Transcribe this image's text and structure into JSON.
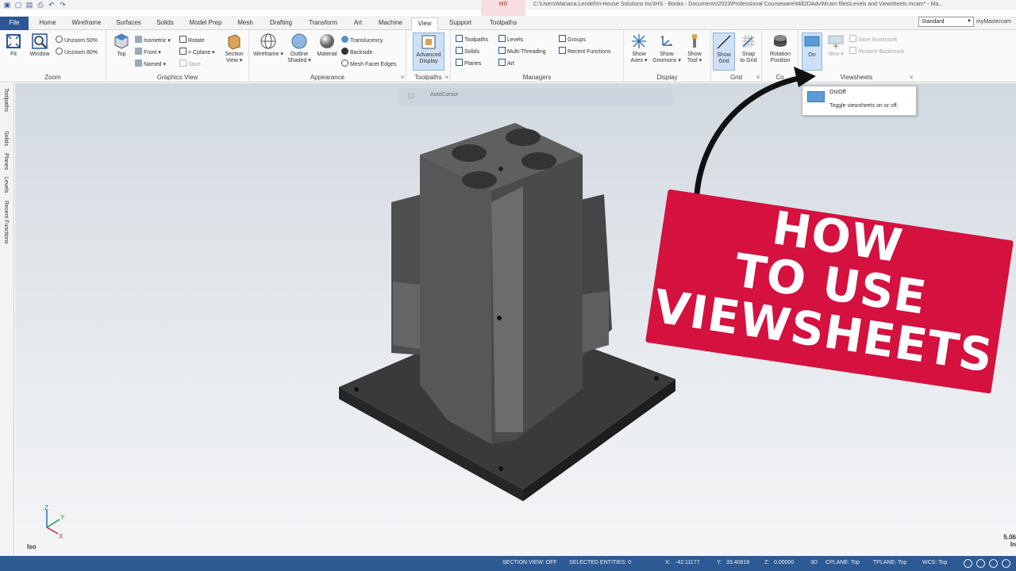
{
  "window": {
    "title": "C:\\Users\\Mariana.Lendel\\In-House Solutions Inc\\IHS - Books - Documents\\2023\\Professional Courseware\\Mill2DAdv\\Mcam files\\Levels and Viewsheets.mcam* - Ma...",
    "context_group": "Mill"
  },
  "tabs": [
    "File",
    "Home",
    "Wireframe",
    "Surfaces",
    "Solids",
    "Model Prep",
    "Mesh",
    "Drafting",
    "Transform",
    "Art",
    "Machine",
    "View",
    "Support",
    "Toolpaths"
  ],
  "active_tab": "View",
  "config_select": "Standard",
  "my_mastercam": "myMastercam",
  "ribbon": {
    "zoom": {
      "label": "Zoom",
      "fit": "Fit",
      "window": "Window",
      "unzoom50": "Unzoom 50%",
      "unzoom80": "Unzoom 80%"
    },
    "graphics_view": {
      "label": "Graphics View",
      "top": "Top",
      "isometric": "Isometric",
      "front": "Front",
      "named": "Named",
      "rotate": "Rotate",
      "cplane": "= Cplane",
      "save": "Save",
      "section_view": "Section",
      "section_view2": "View"
    },
    "appearance": {
      "label": "Appearance",
      "wireframe": "Wireframe",
      "outline": "Outline",
      "outline2": "Shaded",
      "material": "Material",
      "translucency": "Translucency",
      "backside": "Backside",
      "mesh_facet_edges": "Mesh Facet Edges"
    },
    "toolpaths": {
      "label": "Toolpaths",
      "advanced_display": "Advanced",
      "advanced_display2": "Display"
    },
    "managers": {
      "label": "Managers",
      "toolpaths": "Toolpaths",
      "solids": "Solids",
      "planes": "Planes",
      "levels": "Levels",
      "multi_threading": "Multi-Threading",
      "art": "Art",
      "groups": "Groups",
      "recent_functions": "Recent Functions"
    },
    "display": {
      "label": "Display",
      "show_axes": "Show",
      "show_axes2": "Axes",
      "show_gnomons": "Show",
      "show_gnomons2": "Gnomons",
      "show_tool": "Show",
      "show_tool2": "Tool"
    },
    "grid": {
      "label": "Grid",
      "show_grid": "Show",
      "show_grid2": "Grid",
      "snap_to_grid": "Snap",
      "snap_to_grid2": "to Grid"
    },
    "controller": {
      "label": "Co",
      "rotation_position": "Rotation",
      "rotation_position2": "Position"
    },
    "viewsheets": {
      "label": "Viewsheets",
      "on": "On",
      "new": "New",
      "save_bookmark": "Save Bookmark",
      "restore_bookmark": "Restore Bookmark"
    }
  },
  "left_panel": [
    "Toolpaths",
    "Solids",
    "Planes",
    "Levels",
    "Recent Functions"
  ],
  "viewport": {
    "autocursor": "AutoCursor",
    "view_name": "Iso",
    "scale_value": "5.06",
    "scale_unit": "In",
    "gnomon": {
      "x": "X",
      "y": "Y",
      "z": "Z"
    }
  },
  "tooltip": {
    "title": "On/Off",
    "description": "Toggle viewsheets on or off."
  },
  "banner": {
    "line1": "HOW",
    "line2": "TO USE",
    "line3": "VIEWSHEETS"
  },
  "statusbar": {
    "section_view": "SECTION VIEW: OFF",
    "selected": "SELECTED ENTITIES: 0",
    "x_label": "X:",
    "x_value": "-42.11177",
    "y_label": "Y:",
    "y_value": "33.40818",
    "z_label": "Z:",
    "z_value": "0.00000",
    "mode": "3D",
    "cplane": "CPLANE: Top",
    "tplane": "TPLANE: Top",
    "wcs": "WCS: Top"
  },
  "colors": {
    "accent": "#2b579a",
    "banner": "#d4113f",
    "statusbar": "#2e5a93"
  }
}
